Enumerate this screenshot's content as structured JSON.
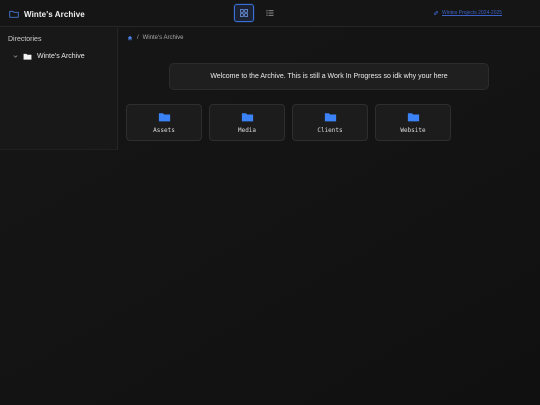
{
  "header": {
    "title": "Winte's Archive",
    "link_text": "Wintes Projects 2024-2025",
    "icons": {
      "brand": "folder-outline-icon",
      "grid_view": "grid-icon",
      "list_view": "list-icon",
      "link": "link-icon"
    }
  },
  "sidebar": {
    "title": "Directories",
    "tree": [
      {
        "label": "Winte's Archive",
        "expanded": true
      }
    ]
  },
  "breadcrumb": {
    "items": [
      "Winte's Archive"
    ]
  },
  "welcome_message": "Welcome to the Archive. This is still a Work In Progress so idk why your here",
  "folders": [
    {
      "name": "Assets"
    },
    {
      "name": "Media"
    },
    {
      "name": "Clients"
    },
    {
      "name": "Website"
    }
  ],
  "colors": {
    "accent": "#3b82f6",
    "background": "#121212",
    "card": "#1c1c1c"
  }
}
